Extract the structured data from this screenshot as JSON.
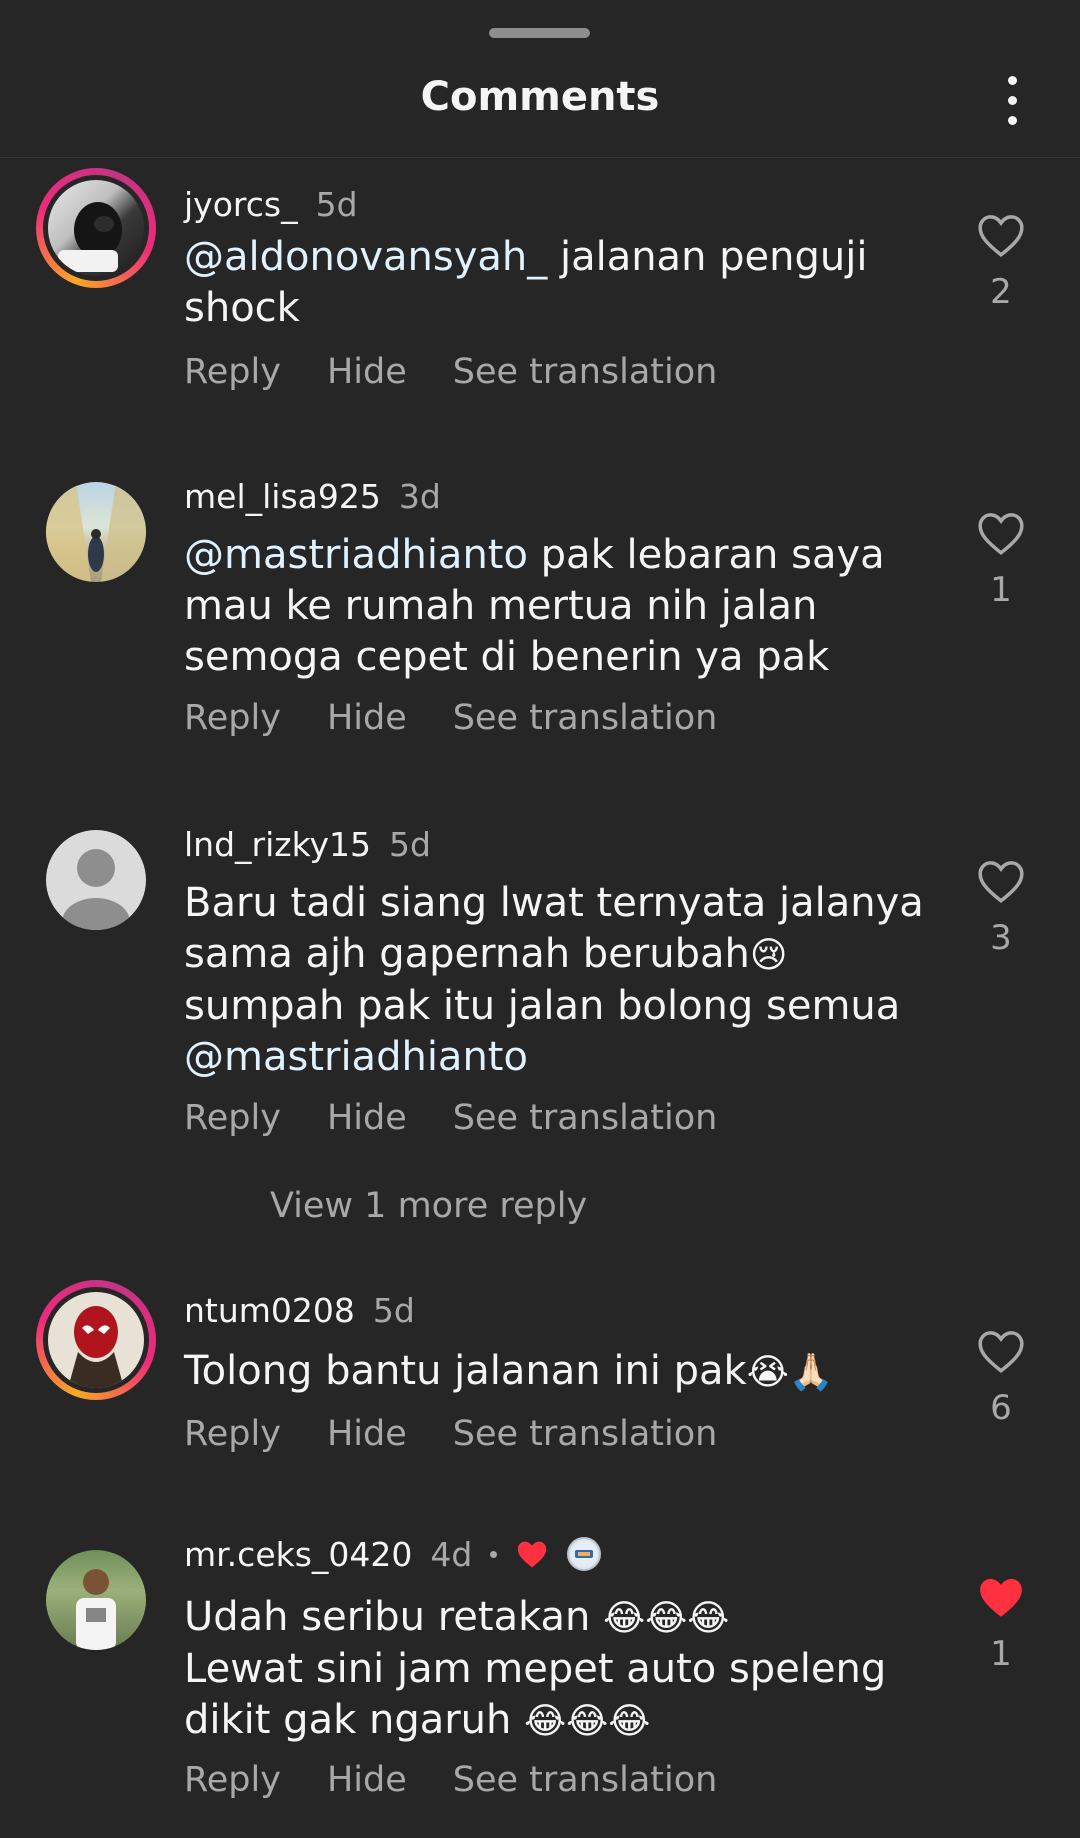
{
  "header": {
    "title": "Comments",
    "menu_icon": "more-vertical-icon"
  },
  "actions": {
    "reply": "Reply",
    "hide": "Hide",
    "see_translation": "See translation"
  },
  "colors": {
    "background": "#262626",
    "secondary_text": "#a8a8a8",
    "like_red": "#ff3040",
    "mention": "#e0f1ff"
  },
  "comments": [
    {
      "username": "jyorcs_",
      "time": "5d",
      "mention": "@aldonovansyah_",
      "text_line1": " jalanan penguji",
      "text_line2": "shock",
      "likes": "2",
      "liked": false,
      "story_ring": true
    },
    {
      "username": "mel_lisa925",
      "time": "3d",
      "mention": "@mastriadhianto",
      "text_line1": " pak lebaran saya",
      "text_line2": "mau ke rumah mertua nih jalan",
      "text_line3": "semoga cepet di benerin ya pak",
      "likes": "1",
      "liked": false,
      "story_ring": false
    },
    {
      "username": "lnd_rizky15",
      "time": "5d",
      "text_line1": "Baru tadi siang lwat ternyata jalanya",
      "text_line2": "sama ajh gapernah berubah",
      "emoji2": "😢",
      "text_line3": "sumpah pak itu jalan bolong semua",
      "mention": "@mastriadhianto",
      "likes": "3",
      "liked": false,
      "story_ring": false
    },
    {
      "username": "ntum0208",
      "time": "5d",
      "text_line1": "Tolong bantu jalanan ini pak",
      "emoji1": "😭🙏🏻",
      "likes": "6",
      "liked": false,
      "story_ring": true
    },
    {
      "username": "mr.ceks_0420",
      "time": "4d",
      "liked_by_author": true,
      "text_line1": "Udah seribu retakan ",
      "emoji1": "😂😂😂",
      "text_line2": "Lewat sini jam mepet auto speleng",
      "text_line3": "dikit gak ngaruh ",
      "emoji3": "😂😂😂",
      "likes": "1",
      "liked": true,
      "story_ring": false
    }
  ],
  "view_more_reply": "View 1 more reply"
}
